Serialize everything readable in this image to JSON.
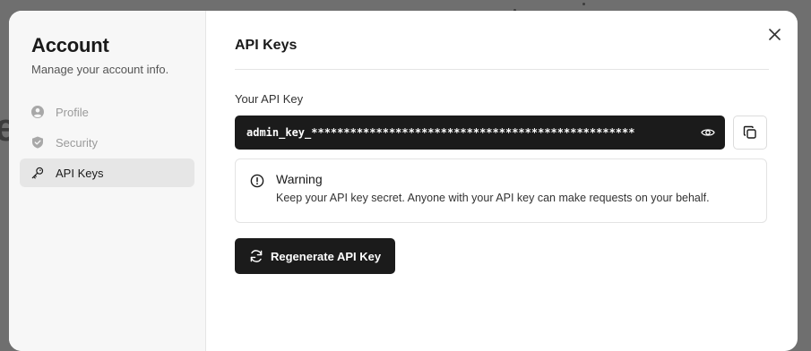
{
  "sidebar": {
    "title": "Account",
    "subtitle": "Manage your account info.",
    "items": [
      {
        "label": "Profile",
        "icon": "user-circle-icon"
      },
      {
        "label": "Security",
        "icon": "shield-icon"
      },
      {
        "label": "API Keys",
        "icon": "key-icon",
        "active": true
      }
    ]
  },
  "content": {
    "title": "API Keys",
    "field_label": "Your API Key",
    "api_key_masked": "admin_key_**************************************************",
    "warning_title": "Warning",
    "warning_text": "Keep your API key secret. Anyone with your API key can make requests on your behalf.",
    "regenerate_label": "Regenerate API Key"
  },
  "colors": {
    "accent_dark": "#1b1b1b",
    "overlay": "#6f6f6f",
    "sidebar_bg": "#f7f7f7",
    "active_item_bg": "#e6e6e6"
  }
}
